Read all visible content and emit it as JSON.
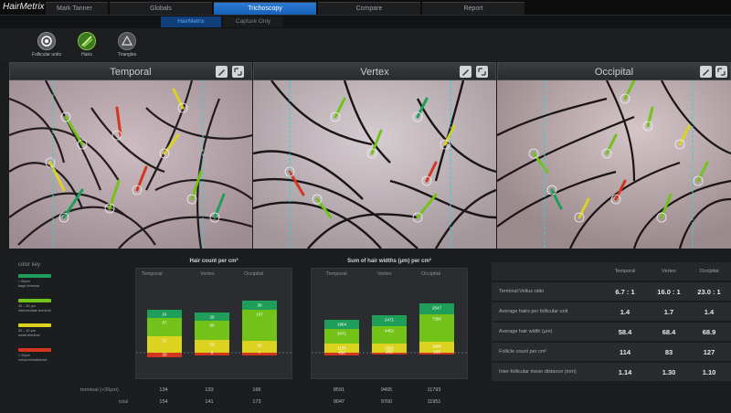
{
  "app": {
    "logo": "HairMetrix"
  },
  "nav": {
    "patient": "Mark Tanner",
    "tabs": [
      "Globals",
      "Trichoscopy",
      "Compare",
      "Report"
    ],
    "active_tab": "Trichoscopy"
  },
  "subnav": {
    "tabs": [
      "HairMetrix",
      "Capture Only"
    ],
    "active": "HairMetrix"
  },
  "tools": [
    {
      "label": "Follicular units",
      "icon": "target-icon"
    },
    {
      "label": "Hairs",
      "icon": "hair-icon"
    },
    {
      "label": "Triangles",
      "icon": "triangle-icon"
    }
  ],
  "panels": [
    {
      "title": "Temporal"
    },
    {
      "title": "Vertex"
    },
    {
      "title": "Occipital"
    }
  ],
  "color_key": {
    "title": "color key",
    "items": [
      {
        "color": "#1f9e5a",
        "text": "> 60μm\nlarge terminal"
      },
      {
        "color": "#73c21a",
        "text": "40 – 60 μm\nintermediate terminal"
      },
      {
        "color": "#dcd321",
        "text": "30 – 40 μm\nsmall terminal"
      },
      {
        "color": "#d3361f",
        "text": "< 30μm\nvellus/miniaturized"
      }
    ]
  },
  "hair_count_chart": {
    "title": "Hair count per cm²",
    "columns": [
      "Temporal",
      "Vertex",
      "Occipital"
    ],
    "segments": [
      [
        {
          "v": "24",
          "c": "#1f9e5a",
          "h": 9
        },
        {
          "v": "67",
          "c": "#73c21a",
          "h": 20
        },
        {
          "v": "37",
          "c": "#dcd321",
          "h": 18
        },
        {
          "v": "20",
          "c": "#d3361f",
          "h": 5
        }
      ],
      [
        {
          "v": "29",
          "c": "#1f9e5a",
          "h": 9
        },
        {
          "v": "60",
          "c": "#73c21a",
          "h": 21
        },
        {
          "v": "26",
          "c": "#dcd321",
          "h": 14
        },
        {
          "v": "8",
          "c": "#d3361f",
          "h": 3
        }
      ],
      [
        {
          "v": "39",
          "c": "#1f9e5a",
          "h": 10
        },
        {
          "v": "107",
          "c": "#73c21a",
          "h": 34
        },
        {
          "v": "20",
          "c": "#dcd321",
          "h": 13
        },
        {
          "v": "7",
          "c": "#d3361f",
          "h": 3
        }
      ]
    ],
    "rows": [
      {
        "label": "terminal (>30μm)",
        "values": [
          "134",
          "133",
          "166"
        ]
      },
      {
        "label": "total",
        "values": [
          "154",
          "141",
          "173"
        ]
      }
    ]
  },
  "hair_width_chart": {
    "title": "Sum of hair widths (μm) per cm²",
    "columns": [
      "Temporal",
      "Vertex",
      "Occipital"
    ],
    "segments": [
      [
        {
          "v": "1964",
          "c": "#1f9e5a",
          "h": 10
        },
        {
          "v": "3471",
          "c": "#73c21a",
          "h": 16
        },
        {
          "v": "1156",
          "c": "#dcd321",
          "h": 10
        },
        {
          "v": "456",
          "c": "#d3361f",
          "h": 3
        }
      ],
      [
        {
          "v": "2471",
          "c": "#1f9e5a",
          "h": 12
        },
        {
          "v": "4452",
          "c": "#73c21a",
          "h": 19
        },
        {
          "v": "1582",
          "c": "#dcd321",
          "h": 10
        },
        {
          "v": "205",
          "c": "#d3361f",
          "h": 2
        }
      ],
      [
        {
          "v": "2547",
          "c": "#1f9e5a",
          "h": 12
        },
        {
          "v": "7380",
          "c": "#73c21a",
          "h": 30
        },
        {
          "v": "1866",
          "c": "#dcd321",
          "h": 12
        },
        {
          "v": "158",
          "c": "#d3361f",
          "h": 2
        }
      ]
    ],
    "rows": [
      {
        "values": [
          "8591",
          "9405",
          "11793"
        ]
      },
      {
        "values": [
          "9047",
          "9700",
          "11951"
        ]
      }
    ]
  },
  "stats_table": {
    "columns": [
      "Temporal",
      "Vertex",
      "Occipital"
    ],
    "rows": [
      {
        "label": "Terminal:Vellus ratio",
        "values": [
          "6.7 : 1",
          "16.0 : 1",
          "23.0 : 1"
        ]
      },
      {
        "label": "Average hairs per follicular unit",
        "values": [
          "1.4",
          "1.7",
          "1.4"
        ]
      },
      {
        "label": "Average hair width (μm)",
        "values": [
          "58.4",
          "68.4",
          "68.9"
        ]
      },
      {
        "label": "Follicle count per cm²",
        "values": [
          "114",
          "83",
          "127"
        ]
      },
      {
        "label": "Inter-follicular mean distance (mm)",
        "values": [
          "1.14",
          "1.30",
          "1.10"
        ]
      }
    ]
  }
}
